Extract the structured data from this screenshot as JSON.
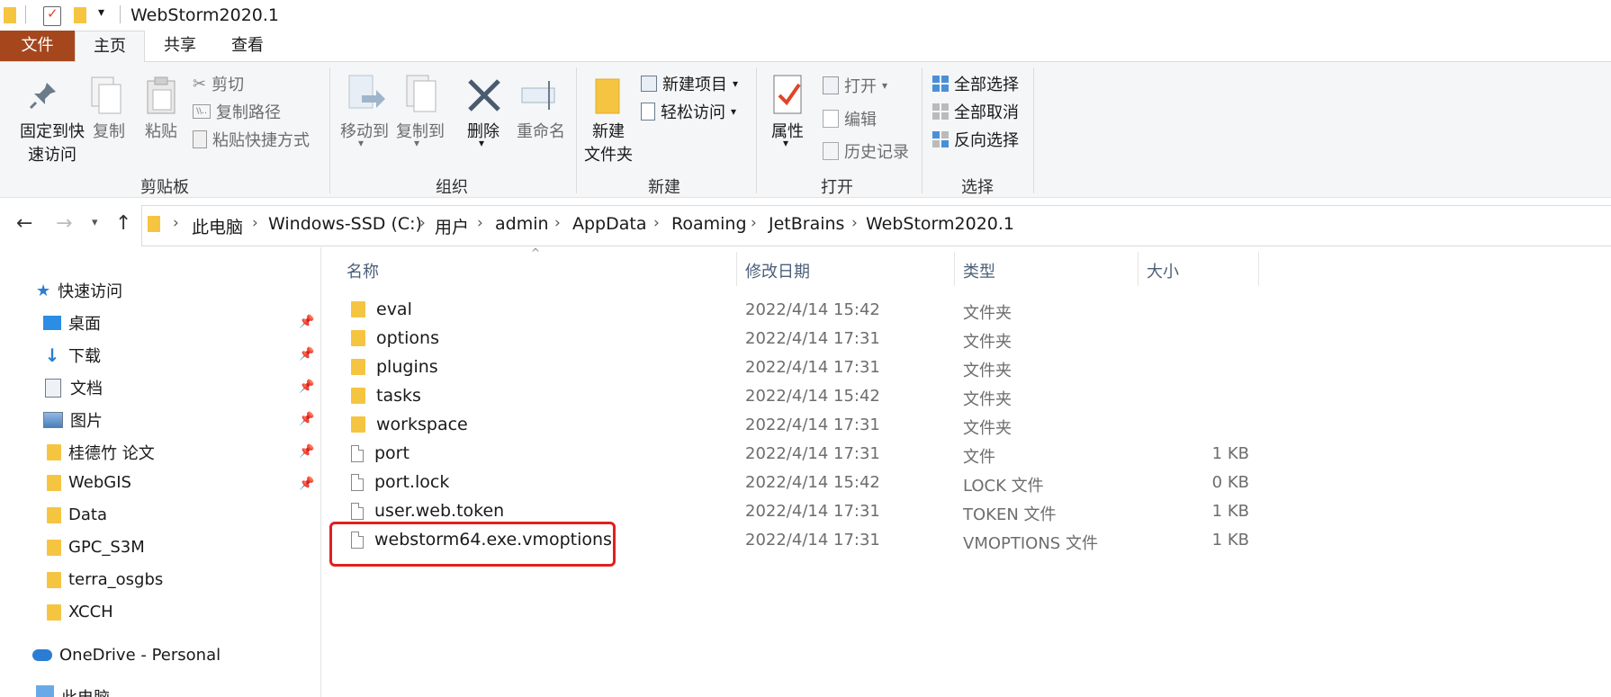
{
  "window": {
    "title": "WebStorm2020.1"
  },
  "tabs": {
    "file": "文件",
    "home": "主页",
    "share": "共享",
    "view": "查看"
  },
  "ribbon": {
    "clipboard": {
      "pin": "固定到快\n速访问",
      "copy": "复制",
      "paste": "粘贴",
      "cut": "剪切",
      "copy_path": "复制路径",
      "paste_shortcut": "粘贴快捷方式",
      "label": "剪贴板"
    },
    "organize": {
      "move_to": "移动到",
      "copy_to": "复制到",
      "delete": "删除",
      "rename": "重命名",
      "label": "组织"
    },
    "new": {
      "new_folder": "新建\n文件夹",
      "new_item": "新建项目",
      "easy_access": "轻松访问",
      "label": "新建"
    },
    "open": {
      "properties": "属性",
      "open": "打开",
      "edit": "编辑",
      "history": "历史记录",
      "label": "打开"
    },
    "select": {
      "select_all": "全部选择",
      "select_none": "全部取消",
      "invert": "反向选择",
      "label": "选择"
    }
  },
  "breadcrumb": [
    "此电脑",
    "Windows-SSD (C:)",
    "用户",
    "admin",
    "AppData",
    "Roaming",
    "JetBrains",
    "WebStorm2020.1"
  ],
  "sidebar": {
    "quick_access": "快速访问",
    "items": [
      {
        "label": "桌面",
        "icon": "desktop-icon",
        "pinned": true
      },
      {
        "label": "下载",
        "icon": "download-icon",
        "pinned": true
      },
      {
        "label": "文档",
        "icon": "documents-icon",
        "pinned": true
      },
      {
        "label": "图片",
        "icon": "pictures-icon",
        "pinned": true
      },
      {
        "label": "桂德竹 论文",
        "icon": "folder-icon",
        "pinned": true
      },
      {
        "label": "WebGIS",
        "icon": "folder-icon",
        "pinned": true
      },
      {
        "label": "Data",
        "icon": "folder-icon",
        "pinned": false
      },
      {
        "label": "GPC_S3M",
        "icon": "folder-icon",
        "pinned": false
      },
      {
        "label": "terra_osgbs",
        "icon": "folder-icon",
        "pinned": false
      },
      {
        "label": "XCCH",
        "icon": "folder-icon",
        "pinned": false
      }
    ],
    "onedrive": "OneDrive - Personal",
    "this_pc": "此电脑"
  },
  "file_list": {
    "columns": {
      "name": "名称",
      "modified": "修改日期",
      "type": "类型",
      "size": "大小"
    },
    "rows": [
      {
        "name": "eval",
        "modified": "2022/4/14 15:42",
        "type": "文件夹",
        "size": "",
        "kind": "folder"
      },
      {
        "name": "options",
        "modified": "2022/4/14 17:31",
        "type": "文件夹",
        "size": "",
        "kind": "folder"
      },
      {
        "name": "plugins",
        "modified": "2022/4/14 17:31",
        "type": "文件夹",
        "size": "",
        "kind": "folder"
      },
      {
        "name": "tasks",
        "modified": "2022/4/14 15:42",
        "type": "文件夹",
        "size": "",
        "kind": "folder"
      },
      {
        "name": "workspace",
        "modified": "2022/4/14 17:31",
        "type": "文件夹",
        "size": "",
        "kind": "folder"
      },
      {
        "name": "port",
        "modified": "2022/4/14 17:31",
        "type": "文件",
        "size": "1 KB",
        "kind": "file"
      },
      {
        "name": "port.lock",
        "modified": "2022/4/14 15:42",
        "type": "LOCK 文件",
        "size": "0 KB",
        "kind": "file"
      },
      {
        "name": "user.web.token",
        "modified": "2022/4/14 17:31",
        "type": "TOKEN 文件",
        "size": "1 KB",
        "kind": "file"
      },
      {
        "name": "webstorm64.exe.vmoptions",
        "modified": "2022/4/14 17:31",
        "type": "VMOPTIONS 文件",
        "size": "1 KB",
        "kind": "file"
      }
    ]
  },
  "colors": {
    "file_tab": "#a5461d",
    "highlight_box": "#e02020",
    "folder": "#f5c542"
  }
}
